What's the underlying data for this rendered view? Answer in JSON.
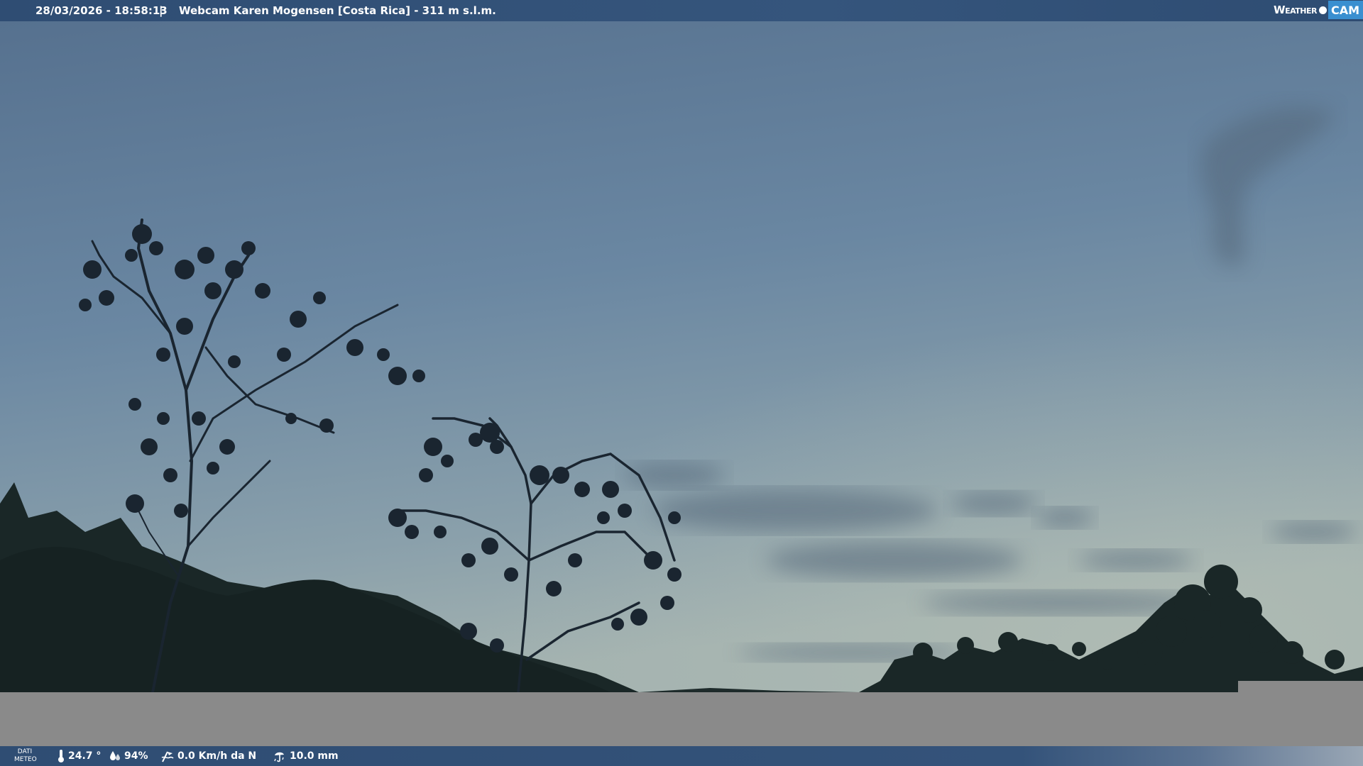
{
  "top_bar": {
    "timestamp": "28/03/2026 - 18:58:13",
    "separator": "|",
    "title": "Webcam Karen Mogensen [Costa Rica] - 311 m s.l.m."
  },
  "logo": {
    "weather": "Weather",
    "cam": "CAM"
  },
  "weather_bar": {
    "label_line1": "DATI",
    "label_line2": "METEO",
    "temperature": "24.7 °",
    "humidity": "94%",
    "wind": "0.0 Km/h da N",
    "rain": "10.0 mm",
    "icons": [
      "thermometer-icon",
      "humidity-icon",
      "wind-icon",
      "rain-icon"
    ]
  },
  "colors": {
    "bar": "#2f4d73",
    "sky_top": "#5a7596",
    "sky_horizon": "#9aaeb2",
    "vegetation": "#1c2a2a",
    "fill_grey": "#8a8a8a",
    "logo_accent": "#3a8fd0"
  }
}
